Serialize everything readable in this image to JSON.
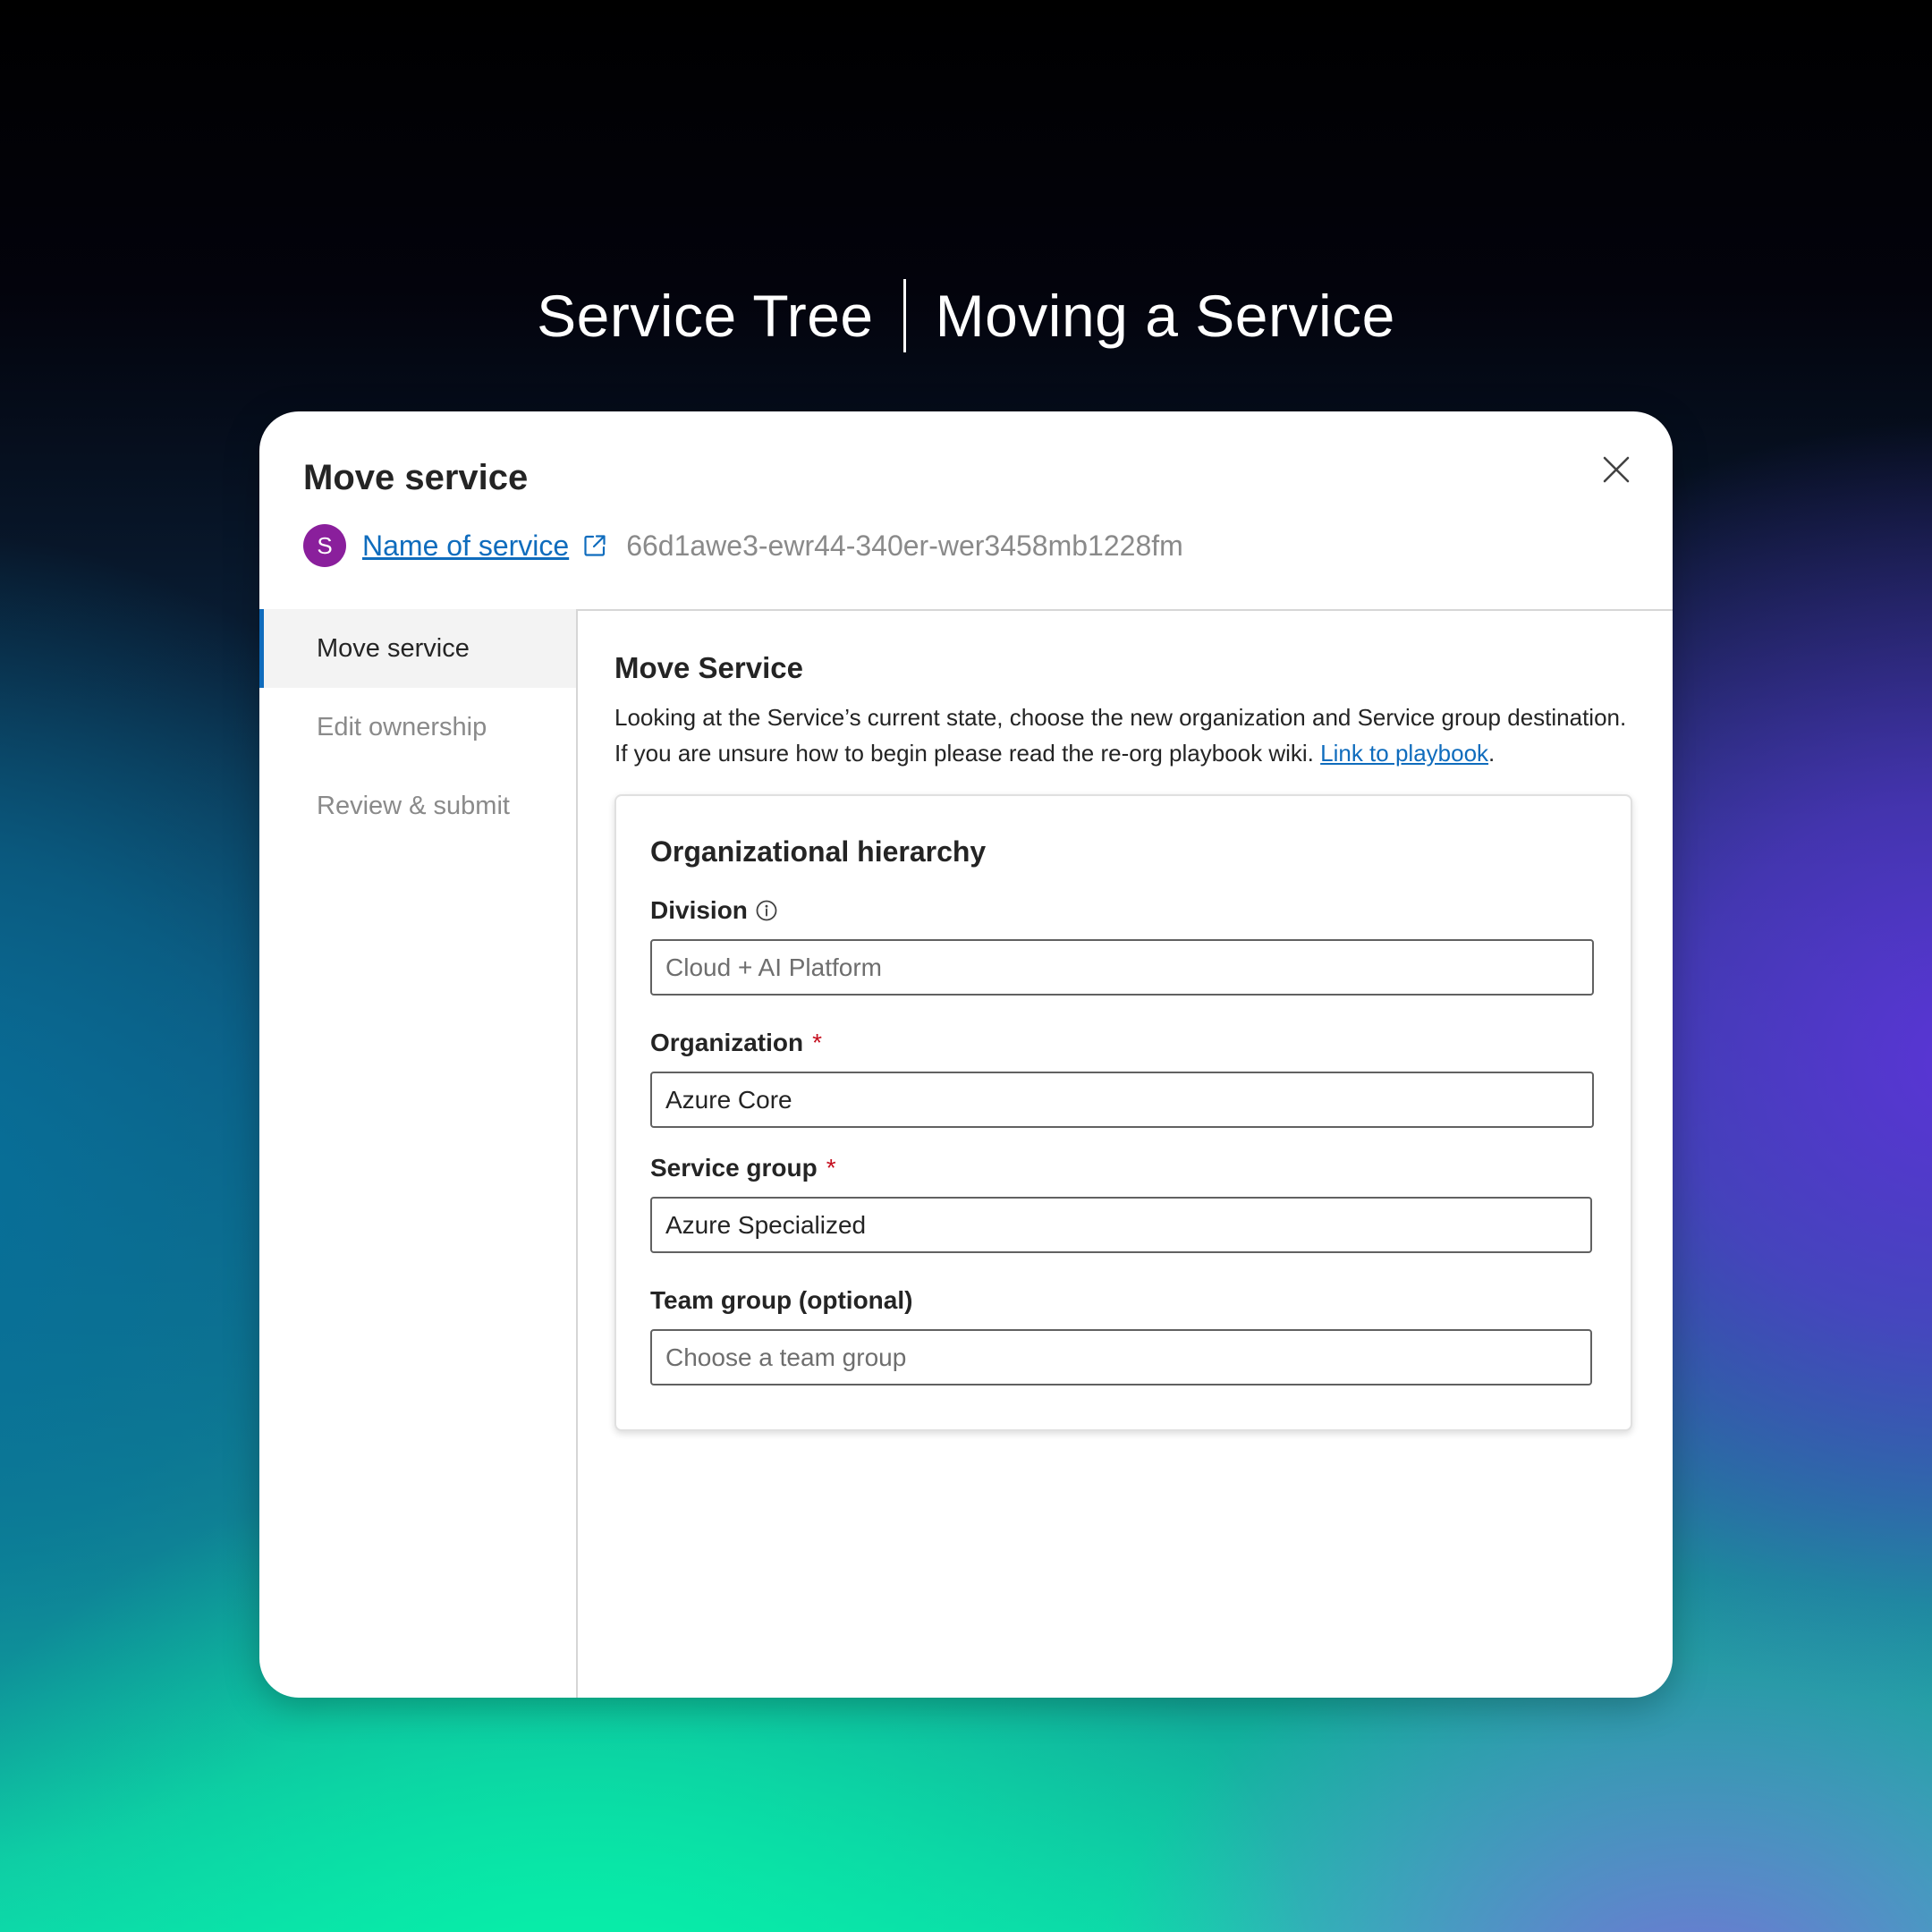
{
  "hero": {
    "left": "Service Tree",
    "right": "Moving a Service"
  },
  "dialog": {
    "title": "Move service",
    "service": {
      "avatar_letter": "S",
      "avatar_color": "#8a1f9c",
      "name": "Name of service",
      "id": "66d1awe3-ewr44-340er-wer3458mb1228fm"
    }
  },
  "nav": {
    "items": [
      {
        "label": "Move service",
        "active": true
      },
      {
        "label": "Edit ownership",
        "active": false
      },
      {
        "label": "Review & submit",
        "active": false
      }
    ]
  },
  "main": {
    "title": "Move Service",
    "desc_line1": "Looking at the Service’s current state, choose the new organization and Service group destination.",
    "desc_line2": "If you are unsure how to begin please read the re-org playbook wiki.",
    "link_label": "Link to playbook",
    "link_suffix": "."
  },
  "panel": {
    "title": "Organizational hierarchy",
    "division": {
      "label": "Division",
      "value": "Cloud + AI Platform"
    },
    "organization": {
      "label": "Organization",
      "required_mark": "*",
      "value": "Azure Core"
    },
    "service_group": {
      "label": "Service group",
      "required_mark": "*",
      "value": "Azure Specialized"
    },
    "team_group": {
      "label": "Team group (optional)",
      "placeholder": "Choose a team group"
    }
  },
  "colors": {
    "accent": "#0f6cbd",
    "required": "#c50f1f",
    "avatar": "#8a1f9c"
  }
}
